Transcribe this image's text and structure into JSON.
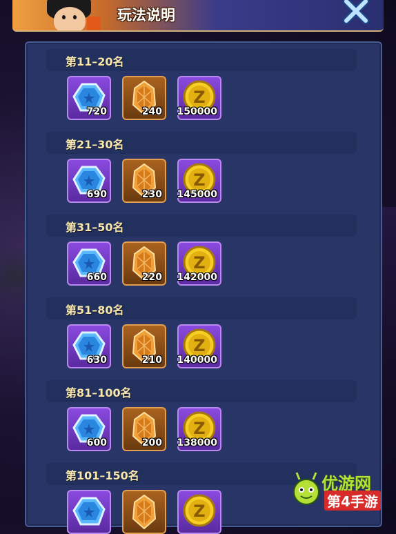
{
  "window": {
    "title": "玩法说明",
    "close_label": "X"
  },
  "tiers": [
    {
      "label": "第11–20名",
      "rewards": [
        {
          "type": "diamond",
          "icon": "blue-gem-icon",
          "count": "720"
        },
        {
          "type": "crystal",
          "icon": "orange-crystal-icon",
          "count": "240"
        },
        {
          "type": "coin",
          "icon": "z-coin-icon",
          "count": "150000"
        }
      ]
    },
    {
      "label": "第21–30名",
      "rewards": [
        {
          "type": "diamond",
          "icon": "blue-gem-icon",
          "count": "690"
        },
        {
          "type": "crystal",
          "icon": "orange-crystal-icon",
          "count": "230"
        },
        {
          "type": "coin",
          "icon": "z-coin-icon",
          "count": "145000"
        }
      ]
    },
    {
      "label": "第31–50名",
      "rewards": [
        {
          "type": "diamond",
          "icon": "blue-gem-icon",
          "count": "660"
        },
        {
          "type": "crystal",
          "icon": "orange-crystal-icon",
          "count": "220"
        },
        {
          "type": "coin",
          "icon": "z-coin-icon",
          "count": "142000"
        }
      ]
    },
    {
      "label": "第51–80名",
      "rewards": [
        {
          "type": "diamond",
          "icon": "blue-gem-icon",
          "count": "630"
        },
        {
          "type": "crystal",
          "icon": "orange-crystal-icon",
          "count": "210"
        },
        {
          "type": "coin",
          "icon": "z-coin-icon",
          "count": "140000"
        }
      ]
    },
    {
      "label": "第81–100名",
      "rewards": [
        {
          "type": "diamond",
          "icon": "blue-gem-icon",
          "count": "600"
        },
        {
          "type": "crystal",
          "icon": "orange-crystal-icon",
          "count": "200"
        },
        {
          "type": "coin",
          "icon": "z-coin-icon",
          "count": "138000"
        }
      ]
    },
    {
      "label": "第101–150名",
      "rewards": [
        {
          "type": "diamond",
          "icon": "blue-gem-icon",
          "count": ""
        },
        {
          "type": "crystal",
          "icon": "orange-crystal-icon",
          "count": ""
        },
        {
          "type": "coin",
          "icon": "z-coin-icon",
          "count": ""
        }
      ]
    }
  ],
  "watermark": {
    "line1": "优游网",
    "line2": "第4手游"
  },
  "colors": {
    "header_left": "#f0a040",
    "header_right": "#2a2f70",
    "panel": "#283566",
    "tier_label": "#f7e7b0",
    "item_purple": "#8a4ae0",
    "item_orange": "#a9621e"
  }
}
